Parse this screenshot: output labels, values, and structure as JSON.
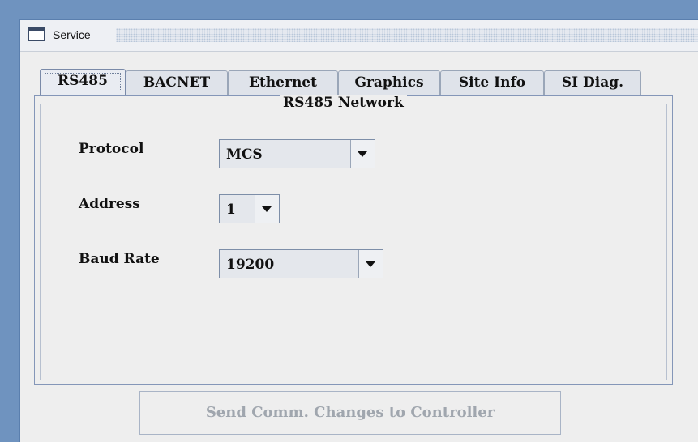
{
  "window": {
    "title": "Service"
  },
  "tabs": [
    {
      "label": "RS485",
      "active": true
    },
    {
      "label": "BACNET",
      "active": false
    },
    {
      "label": "Ethernet",
      "active": false
    },
    {
      "label": "Graphics",
      "active": false
    },
    {
      "label": "Site Info",
      "active": false
    },
    {
      "label": "SI Diag.",
      "active": false
    }
  ],
  "panel": {
    "group_title": "RS485 Network",
    "fields": [
      {
        "label": "Protocol",
        "value": "MCS"
      },
      {
        "label": "Address",
        "value": "1"
      },
      {
        "label": "Baud Rate",
        "value": "19200"
      }
    ]
  },
  "actions": {
    "send_label": "Send Comm. Changes to Controller",
    "send_enabled": false
  }
}
